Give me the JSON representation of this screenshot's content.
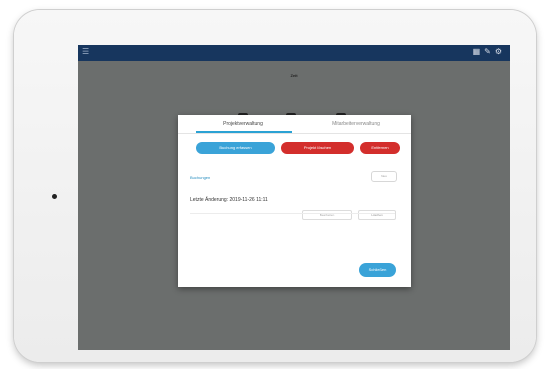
{
  "app": {
    "title": "Zeit"
  },
  "topbar": {
    "menu_icon": "menu-icon",
    "right_icons": [
      "grid-icon",
      "pencil-icon",
      "settings-icon"
    ]
  },
  "dialog": {
    "tabs": [
      {
        "label": "Projektverwaltung",
        "active": true
      },
      {
        "label": "Mitarbeiterverwaltung",
        "active": false
      }
    ],
    "buttons": {
      "primary": "Buchung erfassen",
      "danger1": "Projekt löschen",
      "danger2": "Entfernen"
    },
    "section_label": "Buchungen",
    "section_button": "Neu",
    "item": {
      "text": "Letzte Änderung: 2019-11-26 11:11",
      "action_a": "Bearbeiten",
      "action_b": "Löschen"
    },
    "close_label": "Schließen"
  },
  "colors": {
    "accent": "#3aa3d8",
    "danger": "#d32e2c",
    "topbar": "#17365e",
    "screen_bg": "#6b6e6d"
  }
}
